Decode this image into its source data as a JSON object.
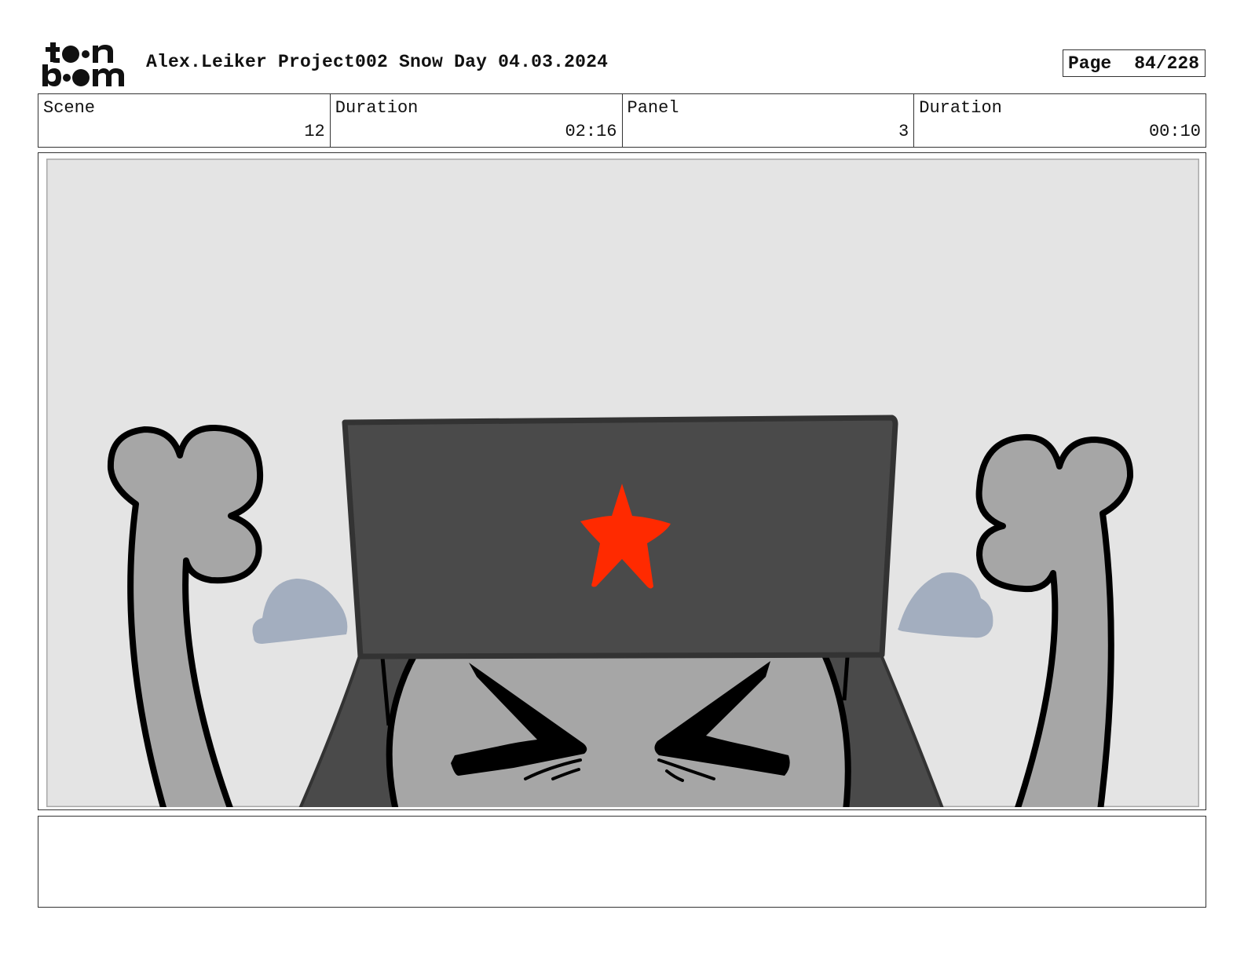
{
  "header": {
    "title": "Alex.Leiker Project002 Snow Day 04.03.2024",
    "page_label": "Page",
    "page_value": "84/228"
  },
  "info": {
    "scene_label": "Scene",
    "scene_value": "12",
    "scene_duration_label": "Duration",
    "scene_duration_value": "02:16",
    "panel_label": "Panel",
    "panel_value": "3",
    "panel_duration_label": "Duration",
    "panel_duration_value": "00:10"
  },
  "panel": {
    "background_color": "#e4e4e4",
    "hat_color": "#4a4a4a",
    "star_color": "#ff2a00",
    "fist_color": "#a6a6a6",
    "puff_color": "#a3aebf"
  },
  "notes": {
    "text": ""
  }
}
